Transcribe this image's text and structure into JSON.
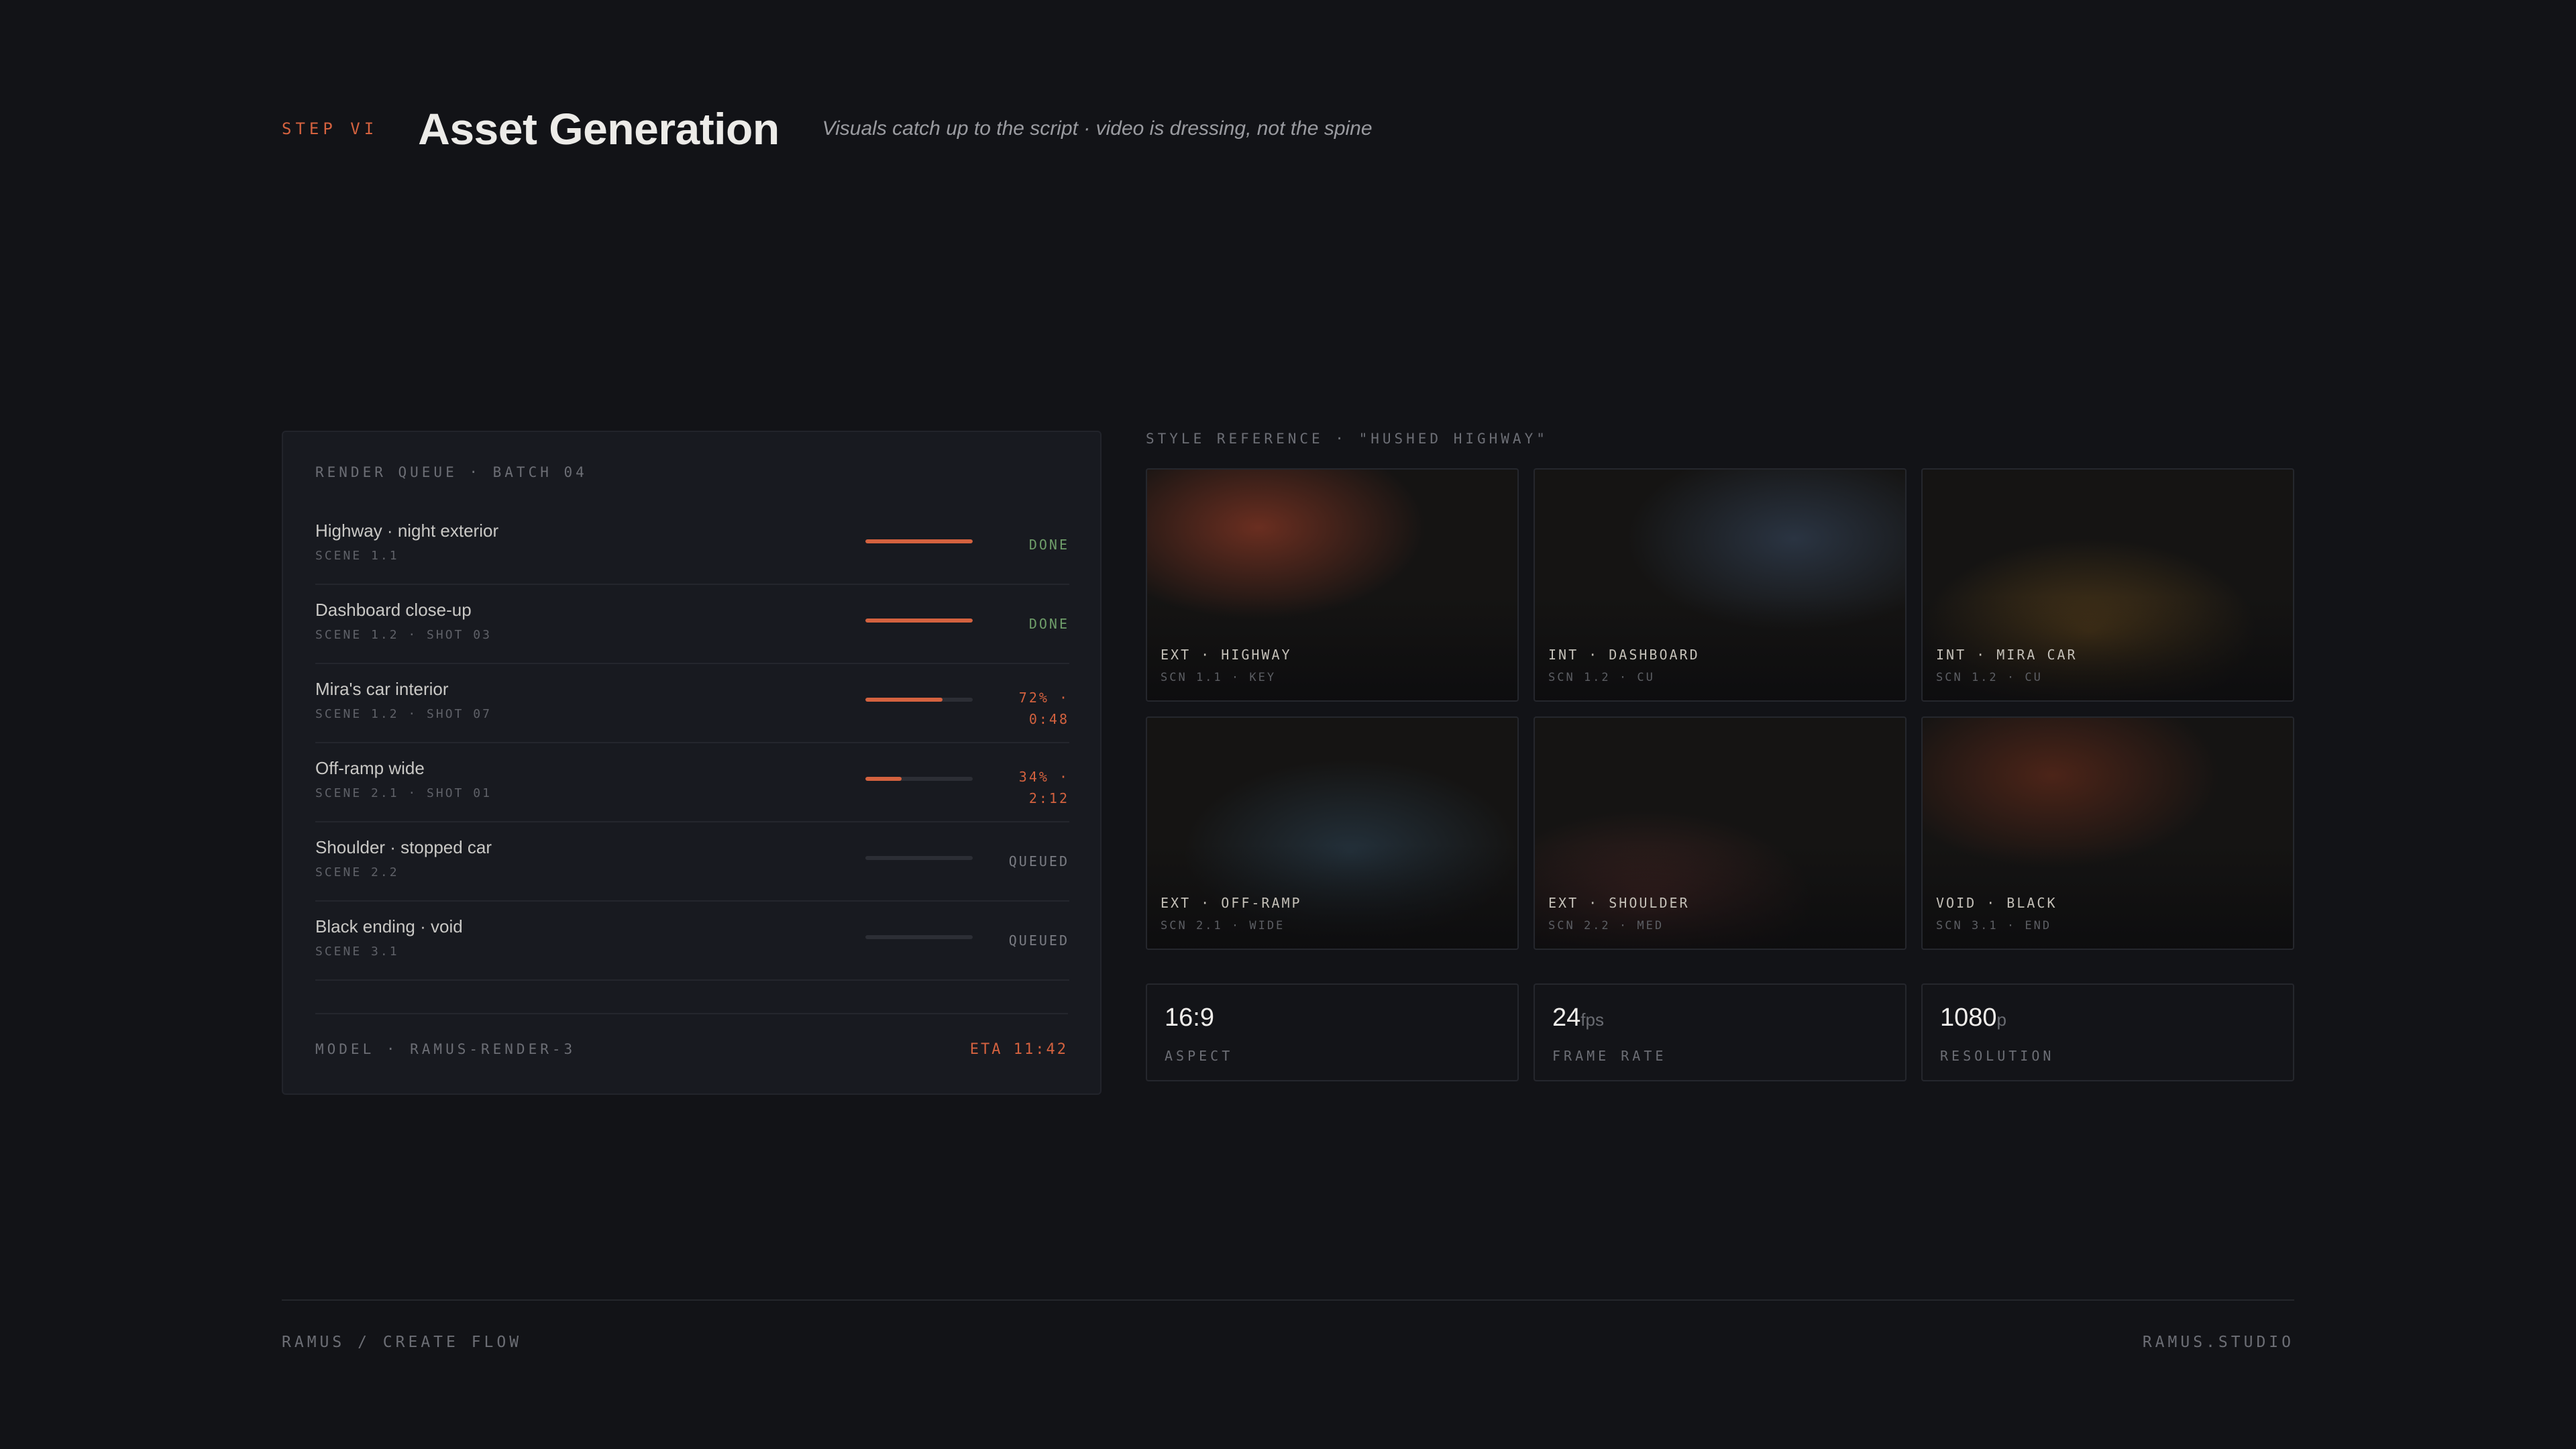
{
  "header": {
    "step": "STEP VI",
    "title": "Asset Generation",
    "subtitle": "Visuals catch up to the script · video is dressing, not the spine"
  },
  "queue": {
    "heading": "RENDER QUEUE · BATCH 04",
    "items": [
      {
        "name": "Highway · night exterior",
        "meta": "SCENE 1.1",
        "progress": 1.0,
        "status": "DONE",
        "status_line2": "",
        "state": "done"
      },
      {
        "name": "Dashboard close-up",
        "meta": "SCENE 1.2 · SHOT 03",
        "progress": 1.0,
        "status": "DONE",
        "status_line2": "",
        "state": "done"
      },
      {
        "name": "Mira's car interior",
        "meta": "SCENE 1.2 · SHOT 07",
        "progress": 0.72,
        "status": "72% ·",
        "status_line2": "0:48",
        "state": "progress"
      },
      {
        "name": "Off-ramp wide",
        "meta": "SCENE 2.1 · SHOT 01",
        "progress": 0.34,
        "status": "34% ·",
        "status_line2": "2:12",
        "state": "progress"
      },
      {
        "name": "Shoulder · stopped car",
        "meta": "SCENE 2.2",
        "progress": 0,
        "status": "QUEUED",
        "status_line2": "",
        "state": "queued"
      },
      {
        "name": "Black ending · void",
        "meta": "SCENE 3.1",
        "progress": 0,
        "status": "QUEUED",
        "status_line2": "",
        "state": "queued"
      }
    ],
    "model": "MODEL · RAMUS-RENDER-3",
    "eta": "ETA 11:42"
  },
  "style_reference": {
    "heading": "STYLE REFERENCE · \"HUSHED HIGHWAY\"",
    "cards": [
      {
        "title": "EXT · HIGHWAY",
        "sub": "SCN 1.1 · KEY",
        "glow": "#6a2e20"
      },
      {
        "title": "INT · DASHBOARD",
        "sub": "SCN 1.2 · CU",
        "glow": "#2a3442"
      },
      {
        "title": "INT · MIRA CAR",
        "sub": "SCN 1.2 · CU",
        "glow": "#4a3618"
      },
      {
        "title": "EXT · OFF-RAMP",
        "sub": "SCN 2.1 · WIDE",
        "glow": "#23303a"
      },
      {
        "title": "EXT · SHOULDER",
        "sub": "SCN 2.2 · MED",
        "glow": "#3e2220"
      },
      {
        "title": "VOID · BLACK",
        "sub": "SCN 3.1 · END",
        "glow": "#4c2418"
      }
    ],
    "specs": [
      {
        "value": "16:9",
        "unit": "",
        "label": "ASPECT"
      },
      {
        "value": "24",
        "unit": "fps",
        "label": "FRAME RATE"
      },
      {
        "value": "1080",
        "unit": "p",
        "label": "RESOLUTION"
      }
    ]
  },
  "footer": {
    "left": "RAMUS / CREATE FLOW",
    "right": "RAMUS.STUDIO"
  },
  "colors": {
    "accent": "#d4623f",
    "done": "#6f9e6a",
    "background": "#121317"
  }
}
